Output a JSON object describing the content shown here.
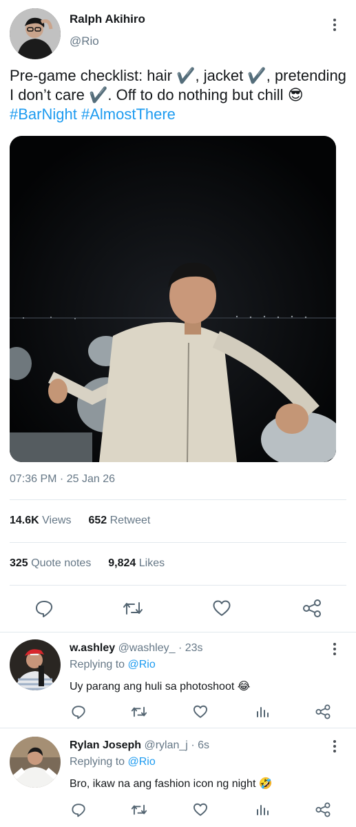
{
  "post": {
    "author_name": "Ralph Akihiro",
    "author_handle": "@Rio",
    "text_part1": "Pre-game checklist: hair ",
    "check_mark": "✔️",
    "text_part2": ", jacket ",
    "text_part3": ", pretending I don’t care ",
    "text_part4": ". Off to do nothing but chill ",
    "emoji": "😎",
    "hashtag1": "#BarNight",
    "hashtag2": "#AlmostThere",
    "timestamp": "07:36 PM · 25 Jan 26"
  },
  "stats": {
    "views_count": "14.6K",
    "views_label": "Views",
    "retweet_count": "652",
    "retweet_label": "Retweet",
    "quote_count": "325",
    "quote_label": "Quote notes",
    "likes_count": "9,824",
    "likes_label": "Likes"
  },
  "replies": [
    {
      "name": "w.ashley",
      "handle": "@washley_",
      "time": "· 23s",
      "replying_label": "Replying to",
      "replying_handle": "@Rio",
      "text": "Uy parang ang huli sa photoshoot 😂"
    },
    {
      "name": "Rylan Joseph",
      "handle": "@rylan_j",
      "time": "· 6s",
      "replying_label": "Replying to",
      "replying_handle": "@Rio",
      "text": "Bro, ikaw na ang fashion icon ng night 🤣"
    }
  ],
  "icons": {
    "reply": "reply-icon",
    "retweet": "retweet-icon",
    "like": "heart-icon",
    "views": "views-icon",
    "share": "share-icon",
    "more": "more-vertical-icon"
  },
  "colors": {
    "accent": "#1d9bf0",
    "muted": "#657786",
    "divider": "#e1e8ed"
  }
}
